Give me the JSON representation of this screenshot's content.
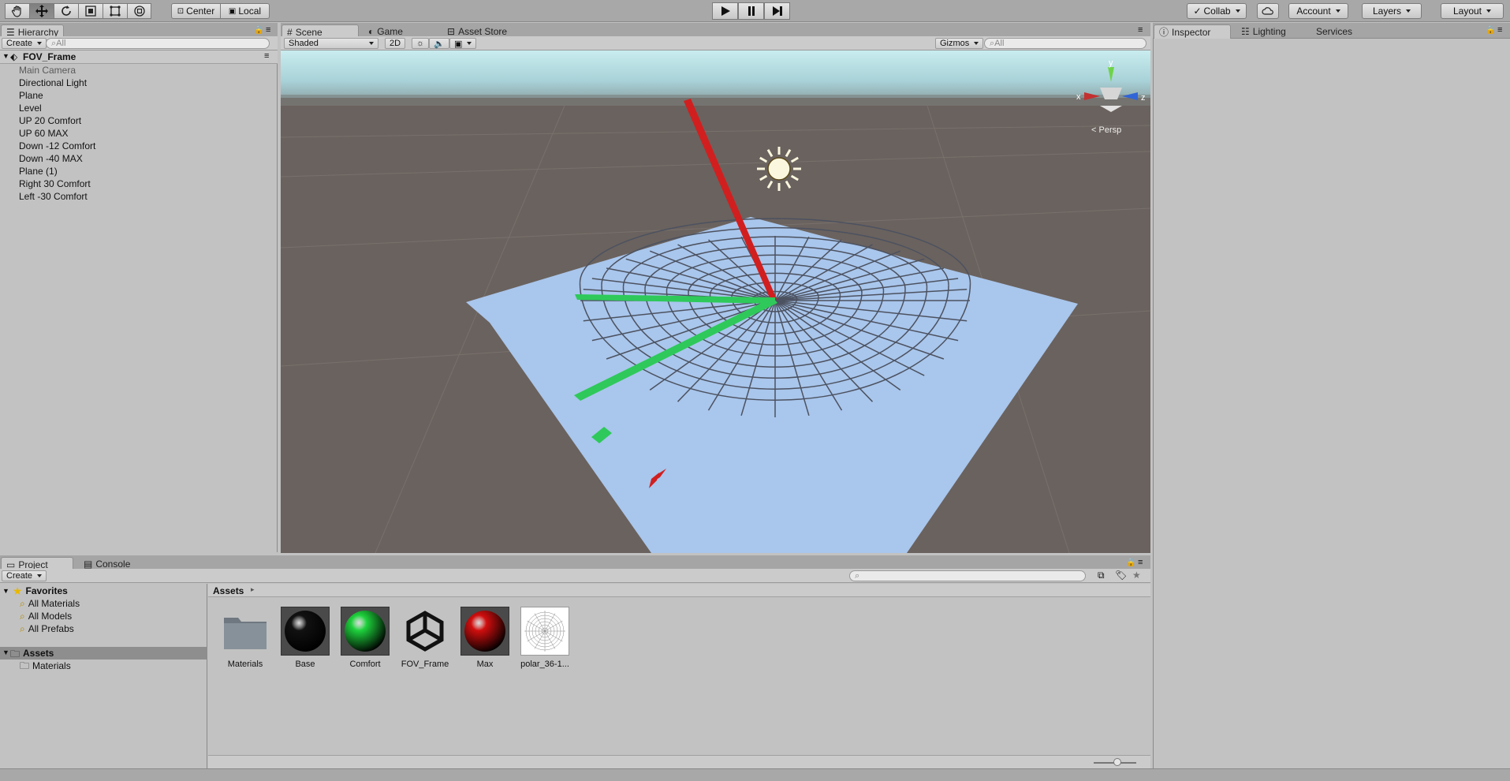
{
  "toolbar": {
    "pivot_label": "Center",
    "space_label": "Local",
    "collab_label": "Collab",
    "account_label": "Account",
    "layers_label": "Layers",
    "layout_label": "Layout"
  },
  "hierarchy": {
    "tab": "Hierarchy",
    "create": "Create",
    "search_placeholder": "All",
    "scene_name": "FOV_Frame",
    "items": [
      "Main Camera",
      "Directional Light",
      "Plane",
      "Level",
      "UP 20 Comfort",
      "UP 60 MAX",
      "Down -12 Comfort",
      "Down -40 MAX",
      "Plane (1)",
      "Right 30 Comfort",
      "Left -30 Comfort"
    ]
  },
  "scene": {
    "tabs": [
      "Scene",
      "Game",
      "Asset Store"
    ],
    "shading": "Shaded",
    "mode_2d": "2D",
    "gizmos": "Gizmos",
    "search_placeholder": "All",
    "persp_label": "Persp",
    "axis_x": "x",
    "axis_y": "y",
    "axis_z": "z",
    "colors": {
      "sky": "#a9d6de",
      "ground": "#6a625e",
      "plane": "#a9c6ec",
      "red_axis": "#d11f1f",
      "green_axis": "#2ec95a"
    }
  },
  "inspector": {
    "tabs": [
      "Inspector",
      "Lighting",
      "Services"
    ]
  },
  "project": {
    "tabs": [
      "Project",
      "Console"
    ],
    "create": "Create",
    "favorites_label": "Favorites",
    "favorites": [
      "All Materials",
      "All Models",
      "All Prefabs"
    ],
    "assets_label": "Assets",
    "asset_folders": [
      "Materials"
    ],
    "breadcrumb": "Assets",
    "assets": [
      {
        "name": "Materials",
        "icon": "folder-icon"
      },
      {
        "name": "Base",
        "icon": "black-sphere-icon",
        "color": "#111111"
      },
      {
        "name": "Comfort",
        "icon": "green-sphere-icon",
        "color": "#1ed13c"
      },
      {
        "name": "FOV_Frame",
        "icon": "unity-logo-icon"
      },
      {
        "name": "Max",
        "icon": "red-sphere-icon",
        "color": "#d10e0e"
      },
      {
        "name": "polar_36-1...",
        "icon": "polar-grid-texture-icon"
      }
    ]
  }
}
